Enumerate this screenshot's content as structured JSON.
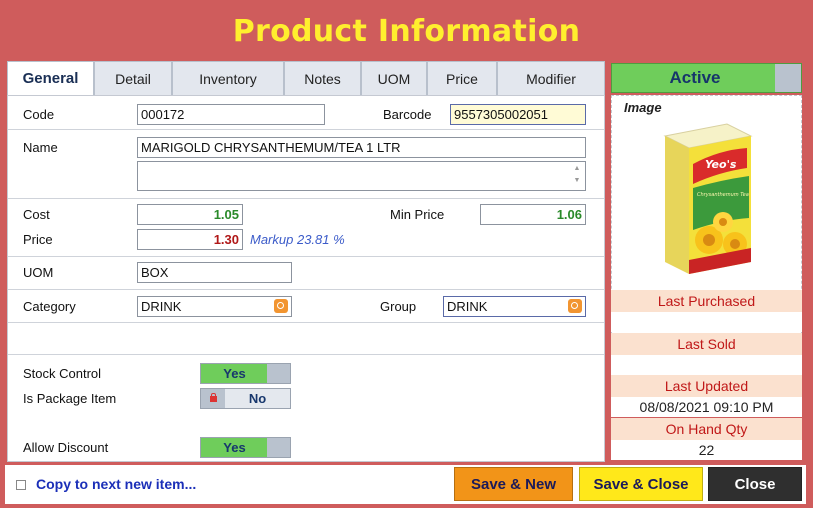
{
  "title": "Product Information",
  "tabs": [
    {
      "label": "General"
    },
    {
      "label": "Detail"
    },
    {
      "label": "Inventory"
    },
    {
      "label": "Notes"
    },
    {
      "label": "UOM"
    },
    {
      "label": "Price"
    },
    {
      "label": "Modifier"
    }
  ],
  "form": {
    "code_label": "Code",
    "code_value": "000172",
    "barcode_label": "Barcode",
    "barcode_value": "9557305002051",
    "name_label": "Name",
    "name_value": "MARIGOLD CHRYSANTHEMUM/TEA 1 LTR",
    "name2_value": "",
    "cost_label": "Cost",
    "cost_value": "1.05",
    "min_price_label": "Min Price",
    "min_price_value": "1.06",
    "price_label": "Price",
    "price_value": "1.30",
    "markup_text": "Markup 23.81 %",
    "uom_label": "UOM",
    "uom_value": "BOX",
    "category_label": "Category",
    "category_value": "DRINK",
    "group_label": "Group",
    "group_value": "DRINK",
    "stock_control_label": "Stock Control",
    "stock_control_value": "Yes",
    "is_package_label": "Is Package Item",
    "is_package_value": "No",
    "allow_discount_label": "Allow Discount",
    "allow_discount_value": "Yes"
  },
  "sidebar": {
    "status_label": "Active",
    "image_label": "Image",
    "product_image": {
      "brand_text": "Yeo's",
      "product_text": "Chrysanthemum Tea"
    },
    "last_purchased_label": "Last Purchased",
    "last_purchased_value": "",
    "last_sold_label": "Last Sold",
    "last_sold_value": "",
    "last_updated_label": "Last Updated",
    "last_updated_value": "08/08/2021 09:10 PM",
    "on_hand_label": "On Hand Qty",
    "on_hand_value": "22"
  },
  "footer": {
    "copy_label": "Copy to next new item...",
    "save_new_label": "Save & New",
    "save_close_label": "Save & Close",
    "close_label": "Close"
  },
  "colors": {
    "background": "#cf5c5c",
    "title": "#ffef2e",
    "toggle_on": "#6fcd5b",
    "cost_text": "#2a8a2a",
    "price_text": "#b01818",
    "markup_text": "#3b5bc9",
    "save_new_bg": "#f29418",
    "save_close_bg": "#ffe81a",
    "close_bg": "#2f2f2f"
  },
  "icons": [
    "lookup-icon",
    "lock-icon",
    "checkbox-icon",
    "scroll-arrows-icon"
  ]
}
